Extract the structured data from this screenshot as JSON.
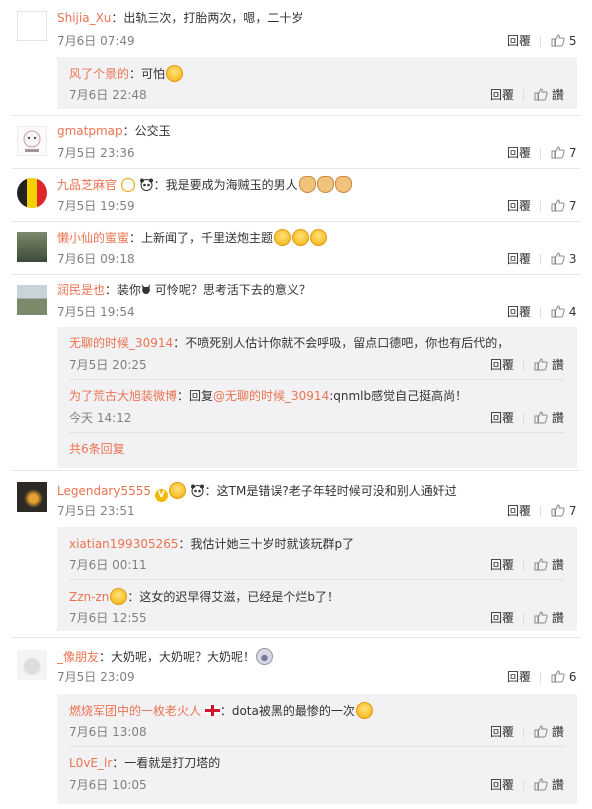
{
  "ui": {
    "reply": "回覆",
    "like_icon": "thumb-up-icon"
  },
  "comments": [
    {
      "user": "Shijia_Xu",
      "text": "：出轨三次，打胎两次，嗯，二十岁",
      "time": "7月6日 07:49",
      "likes": "5",
      "replies": [
        {
          "user": "风了个景的",
          "text": "：可怕",
          "time": "7月6日 22:48",
          "likes": "讚"
        }
      ]
    },
    {
      "user": "gmatpmap",
      "text": "：公交玉",
      "time": "7月5日 23:36",
      "likes": "7"
    },
    {
      "user": "九品芝麻官",
      "text": "：我是要成为海贼玉的男人",
      "time": "7月5日 19:59",
      "likes": "7"
    },
    {
      "user": "懒小仙的蜜蜜",
      "text": "：上新闻了，千里送炮主题",
      "time": "7月6日 09:18",
      "likes": "3"
    },
    {
      "user": "润民是也",
      "text": "：装你",
      "text2": " 可怜呢？思考活下去的意义？",
      "time": "7月5日 19:54",
      "likes": "4",
      "replies": [
        {
          "user": "无聊的时候_30914",
          "text": "：不喷死别人估计你就不会呼吸，留点口德吧，你也有后代的，",
          "time": "7月5日 20:25",
          "likes": "讚"
        },
        {
          "user": "为了荒古大旭装微博",
          "text": "：回复",
          "mention": "@无聊的时候_30914",
          "text2": ":qnmlb感觉自己挺高尚！",
          "time": "今天 14:12",
          "likes": "讚"
        }
      ],
      "more": "共6条回复"
    },
    {
      "user": "Legendary5555",
      "text": "：这TM是错误?老子年轻时候可没和别人通奸过",
      "time": "7月5日 23:51",
      "likes": "7",
      "replies": [
        {
          "user": "xiatian199305265",
          "text": "：我估计她三十岁时就该玩群p了",
          "time": "7月6日 00:11",
          "likes": "讚"
        },
        {
          "user": "Zzn-zn",
          "text": "：这女的迟早得艾滋，已经是个烂b了！",
          "time": "7月6日 12:55",
          "likes": "讚"
        }
      ]
    },
    {
      "user": "_像朋友",
      "text": "：大奶呢，大奶呢？大奶呢！",
      "time": "7月5日 23:09",
      "likes": "6",
      "replies": [
        {
          "user": "燃烧军团中的一枚老火人",
          "text": "：dota被黑的最惨的一次",
          "time": "7月6日 13:08",
          "likes": "讚"
        },
        {
          "user": "L0vE_lr",
          "text": "：一看就是打刀塔的",
          "time": "7月6日 10:05",
          "likes": "讚"
        }
      ]
    }
  ]
}
